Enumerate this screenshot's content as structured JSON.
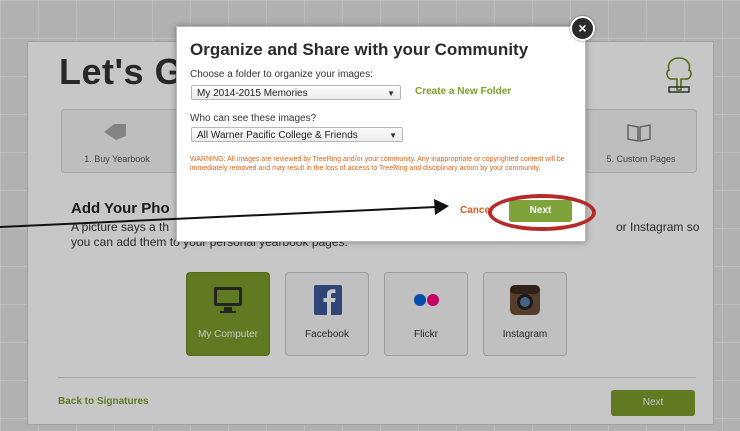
{
  "page": {
    "title": "Let's G",
    "steps": [
      "1. Buy Yearbook",
      "5. Custom Pages"
    ],
    "add_title": "Add Your Pho",
    "add_desc_line1": "A picture says a th",
    "add_desc_right": "or Instagram so",
    "add_desc_line2": "you can add them to your personal yearbook pages.",
    "sources": [
      "My Computer",
      "Facebook",
      "Flickr",
      "Instagram"
    ],
    "back_link": "Back to Signatures",
    "next": "Next"
  },
  "modal": {
    "title": "Organize and Share with your Community",
    "folder_label": "Choose a folder to organize your images:",
    "folder_value": "My 2014-2015 Memories",
    "create_folder": "Create a New Folder",
    "visibility_label": "Who can see these images?",
    "visibility_value": "All Warner Pacific College & Friends",
    "warning": "WARNING: All images are reviewed by TreeRing and/or your community.  Any inappropriate or copyrighted content will be immediately removed and may result in the loss of access to TreeRing and disciplinary action by your community.",
    "cancel": "Cancel",
    "next": "Next",
    "close_symbol": "×"
  },
  "icons": {
    "close": "close-icon",
    "dropdown": "chevron-down-icon",
    "tree": "tree-logo-icon"
  },
  "colors": {
    "green": "#7da33a",
    "warning": "#e8641a",
    "highlight": "#b52a2a"
  }
}
